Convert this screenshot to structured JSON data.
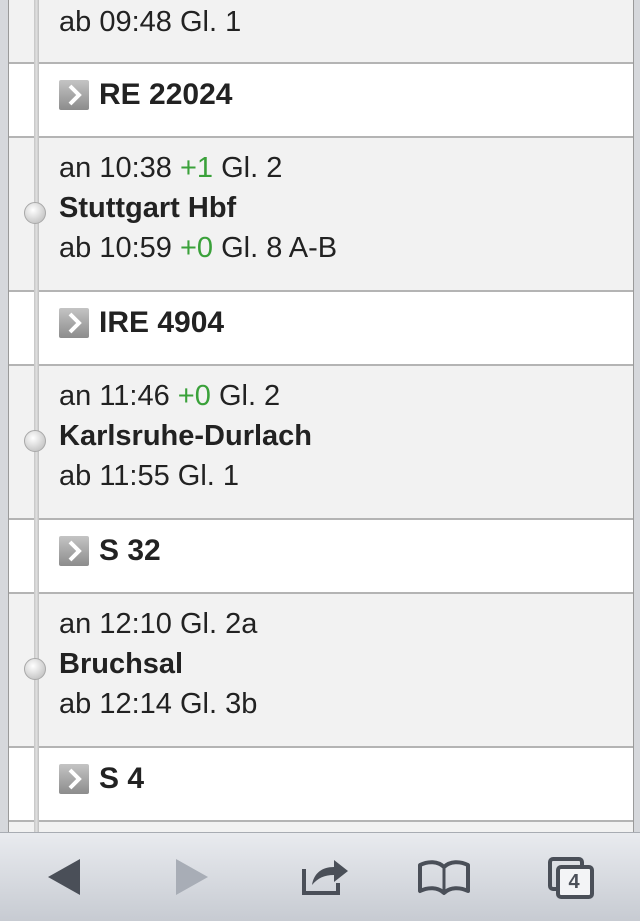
{
  "stops": [
    {
      "ab": "ab 09:48",
      "ab_gl": "Gl. 1"
    },
    {
      "an": "an 10:38",
      "an_delay": "+1",
      "an_gl": "Gl. 2",
      "name": "Stuttgart Hbf",
      "ab": "ab 10:59",
      "ab_delay": "+0",
      "ab_gl": "Gl. 8 A-B"
    },
    {
      "an": "an 11:46",
      "an_delay": "+0",
      "an_gl": "Gl. 2",
      "name": "Karlsruhe-Durlach",
      "ab": "ab 11:55",
      "ab_gl": "Gl. 1"
    },
    {
      "an": "an 12:10",
      "an_gl": "Gl. 2a",
      "name": "Bruchsal",
      "ab": "ab 12:14",
      "ab_gl": "Gl. 3b"
    }
  ],
  "trains": [
    "RE 22024",
    "IRE 4904",
    "S 32",
    "S 4"
  ],
  "toolbar": {
    "back_icon": "back-arrow-icon",
    "forward_icon": "forward-arrow-icon",
    "share_icon": "share-icon",
    "bookmarks_icon": "bookmarks-book-icon",
    "tabs_icon": "tabs-icon",
    "tabs_count": "4"
  },
  "colors": {
    "delay": "#3aa13a",
    "station_bg": "#f2f2f2",
    "train_bg": "#ffffff"
  }
}
